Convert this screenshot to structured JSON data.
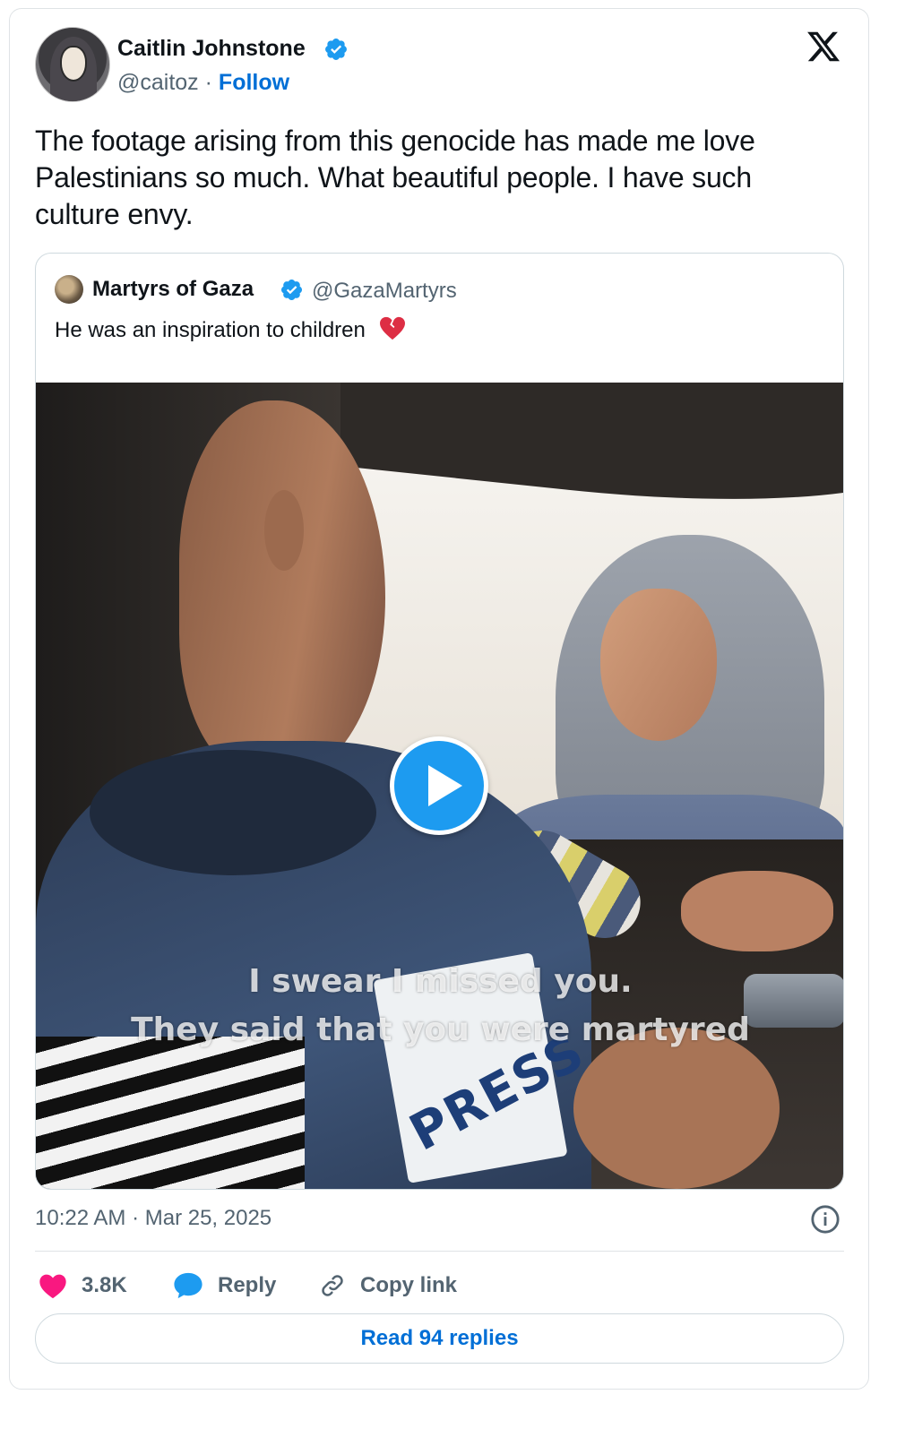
{
  "author": {
    "name": "Caitlin Johnstone",
    "handle": "@caitoz",
    "separator": "·",
    "follow_label": "Follow"
  },
  "tweet": {
    "text": "The footage arising from this genocide has made me love Palestinians so much. What beautiful people. I have such culture envy.",
    "timestamp": "10:22 AM · Mar 25, 2025"
  },
  "quoted": {
    "name": "Martyrs of Gaza",
    "handle": "@GazaMartyrs",
    "text": "He was an inspiration to children",
    "emoji": "broken-heart-emoji",
    "video": {
      "caption_line1": "I swear I missed you.",
      "caption_line2": "They said that you were martyred",
      "vest_text": "PRESS"
    }
  },
  "actions": {
    "likes": "3.8K",
    "reply_label": "Reply",
    "copy_label": "Copy link"
  },
  "read_replies_label": "Read 94 replies",
  "colors": {
    "accent": "#1d9bf0",
    "link": "#006fd6",
    "like": "#f91880",
    "secondary_text": "#536471"
  },
  "icons": [
    "verified-badge-icon",
    "x-logo-icon",
    "play-icon",
    "info-icon",
    "heart-icon",
    "reply-bubble-icon",
    "link-icon"
  ]
}
